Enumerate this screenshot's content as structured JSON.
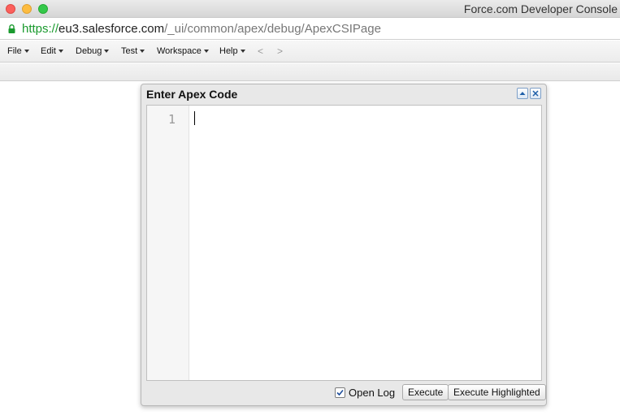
{
  "window": {
    "title": "Force.com Developer Console"
  },
  "address_bar": {
    "scheme": "https://",
    "host": "eu3.salesforce.com",
    "path": "/_ui/common/apex/debug/ApexCSIPage"
  },
  "menu": {
    "items": [
      {
        "label": "File"
      },
      {
        "label": "Edit"
      },
      {
        "label": "Debug"
      },
      {
        "label": "Test"
      },
      {
        "label": "Workspace"
      },
      {
        "label": "Help"
      }
    ],
    "back": "<",
    "forward": ">"
  },
  "dialog": {
    "title": "Enter Apex Code",
    "line_number": "1",
    "code": "",
    "open_log_label": "Open Log",
    "open_log_checked": true,
    "execute_label": "Execute",
    "execute_highlighted_label": "Execute Highlighted"
  },
  "colors": {
    "url_scheme": "#1a9a2e",
    "dialog_button_border": "#7ea0c8"
  }
}
